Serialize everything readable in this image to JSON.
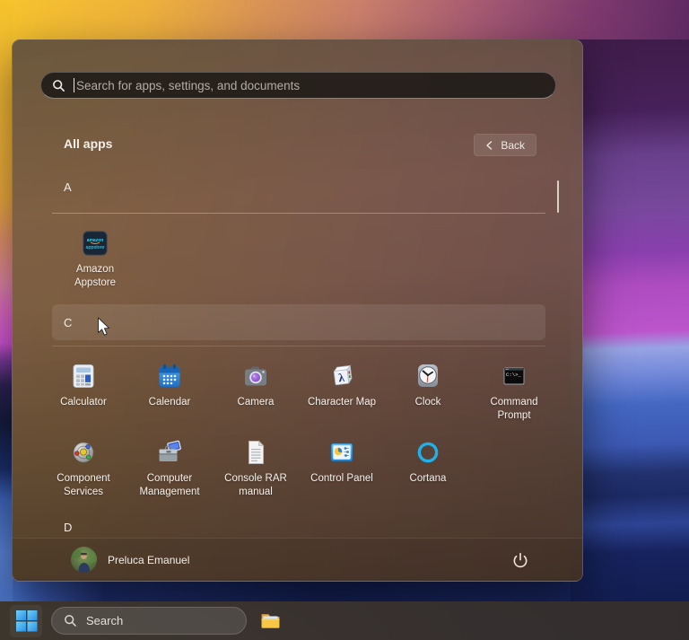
{
  "start_menu": {
    "search_placeholder": "Search for apps, settings, and documents",
    "title": "All apps",
    "back_label": "Back",
    "section_a": "A",
    "section_c": "C",
    "section_d": "D",
    "apps": [
      {
        "label": "Amazon Appstore",
        "icon": "amazon-appstore-icon",
        "section": "A"
      },
      {
        "label": "Calculator",
        "icon": "calculator-icon",
        "section": "C"
      },
      {
        "label": "Calendar",
        "icon": "calendar-icon",
        "section": "C"
      },
      {
        "label": "Camera",
        "icon": "camera-icon",
        "section": "C"
      },
      {
        "label": "Character Map",
        "icon": "character-map-icon",
        "section": "C"
      },
      {
        "label": "Clock",
        "icon": "clock-icon",
        "section": "C"
      },
      {
        "label": "Command Prompt",
        "icon": "command-prompt-icon",
        "section": "C"
      },
      {
        "label": "Component Services",
        "icon": "component-services-icon",
        "section": "C"
      },
      {
        "label": "Computer Management",
        "icon": "computer-management-icon",
        "section": "C"
      },
      {
        "label": "Console RAR manual",
        "icon": "document-icon",
        "section": "C"
      },
      {
        "label": "Control Panel",
        "icon": "control-panel-icon",
        "section": "C"
      },
      {
        "label": "Cortana",
        "icon": "cortana-icon",
        "section": "C"
      }
    ],
    "user_name": "Preluca Emanuel",
    "icons": {
      "search": "search-icon",
      "back": "chevron-left-icon",
      "power": "power-icon",
      "avatar": "user-avatar"
    }
  },
  "taskbar": {
    "search_label": "Search",
    "icons": {
      "start": "windows-start-icon",
      "search": "search-icon",
      "file_explorer": "file-explorer-icon"
    }
  },
  "colors": {
    "accent_blue": "#2f9bea",
    "cortana_blue": "#1fb2ea",
    "folder_yellow": "#f7c747",
    "menu_tint_brown": "#6e5446",
    "taskbar_gray": "#332f2c",
    "hover_row": "rgba(255,255,255,0.09)"
  }
}
